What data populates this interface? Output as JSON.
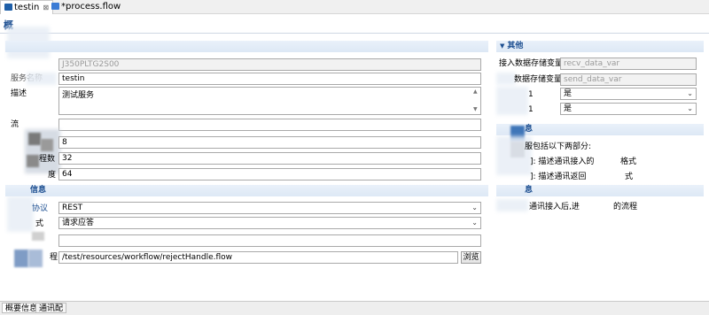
{
  "tabs": [
    {
      "label": "testin",
      "active": true,
      "close": "⊠"
    },
    {
      "label": "*process.flow",
      "active": false
    }
  ],
  "header": {
    "title": "概"
  },
  "left": {
    "fields": {
      "code_value": "J350PLTG2S00",
      "service_label": "服务名称",
      "service_value": "testin",
      "desc_label": "描述",
      "desc_value": "测试服务",
      "flow_label": "流",
      "flow_value": "",
      "max_value": "8",
      "threads_label": "程数",
      "threads_value": "32",
      "degree_label": "度",
      "degree_value": "64"
    },
    "section2": {
      "title": "信息",
      "protocol_label": "协议",
      "protocol_value": "REST",
      "mode_label": "式",
      "mode_value": "请求应答",
      "blank_value": "",
      "path_label": "程",
      "path_value": "/test/resources/workflow/rejectHandle.flow",
      "browse_label": "浏览"
    }
  },
  "right": {
    "section_other": {
      "title": "其他",
      "recv_label": "接入数据存储变量",
      "recv_value": "recv_data_var",
      "send_label": "数据存储变量",
      "send_value": "send_data_var",
      "opt1_label": "1",
      "opt1_value": "是",
      "opt2_label": "1",
      "opt2_value": "是"
    },
    "section_info": {
      "title": "息",
      "line1": "服包括以下两部分:",
      "line2": "]: 描述通讯接入的",
      "line2b": "格式",
      "line3": "]: 描述通讯返回",
      "line3b": "式"
    },
    "section_flow": {
      "title": "息",
      "line1": "通讯接入后,进",
      "line1b": "的流程"
    }
  },
  "bottom_tabs": [
    {
      "label": "概要信息",
      "active": true
    },
    {
      "label": "通讯配",
      "active": false
    }
  ],
  "colors": {
    "accent": "#1d4f91",
    "section_bg": "#dde8f5"
  }
}
